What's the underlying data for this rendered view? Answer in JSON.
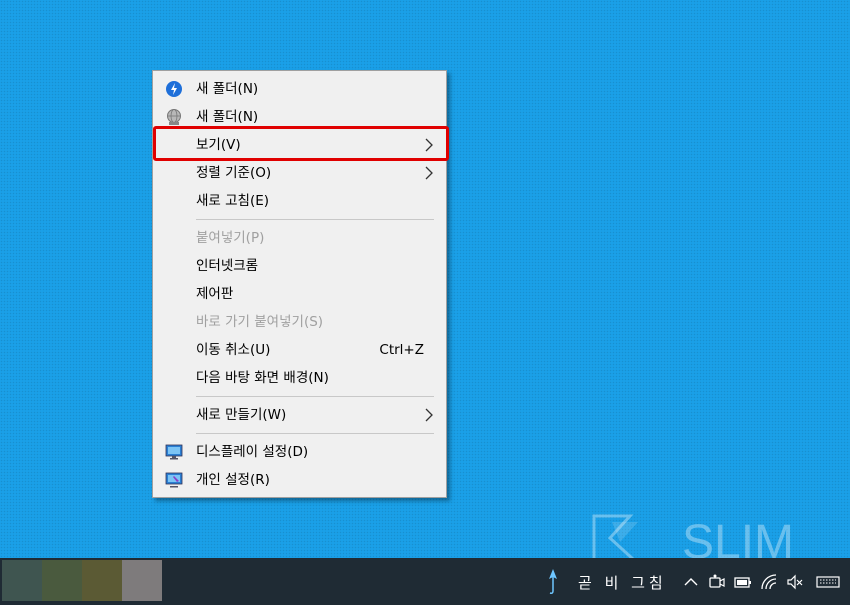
{
  "menu": {
    "items": [
      {
        "label": "새 폴더(N)",
        "icon": "blue-circle-icon"
      },
      {
        "label": "새 폴더(N)",
        "icon": "globe-icon"
      },
      {
        "label": "보기(V)",
        "submenu": true
      },
      {
        "label": "정렬 기준(O)",
        "submenu": true
      },
      {
        "label": "새로 고침(E)"
      },
      {
        "label": "붙여넣기(P)",
        "disabled": true
      },
      {
        "label": "인터넷크롬"
      },
      {
        "label": "제어판"
      },
      {
        "label": "바로 가기 붙여넣기(S)",
        "disabled": true
      },
      {
        "label": "이동 취소(U)",
        "shortcut": "Ctrl+Z"
      },
      {
        "label": "다음 바탕 화면 배경(N)"
      },
      {
        "label": "새로 만들기(W)",
        "submenu": true
      },
      {
        "label": "디스플레이 설정(D)",
        "icon": "display-icon"
      },
      {
        "label": "개인 설정(R)",
        "icon": "personalize-icon"
      }
    ]
  },
  "taskbar": {
    "tray_text": "곧 비 그침"
  },
  "watermark": {
    "text": "SLIM"
  },
  "colors": {
    "desktop": "#1aa0e8",
    "highlight": "#e00000",
    "taskbar": "#1f2b34"
  }
}
